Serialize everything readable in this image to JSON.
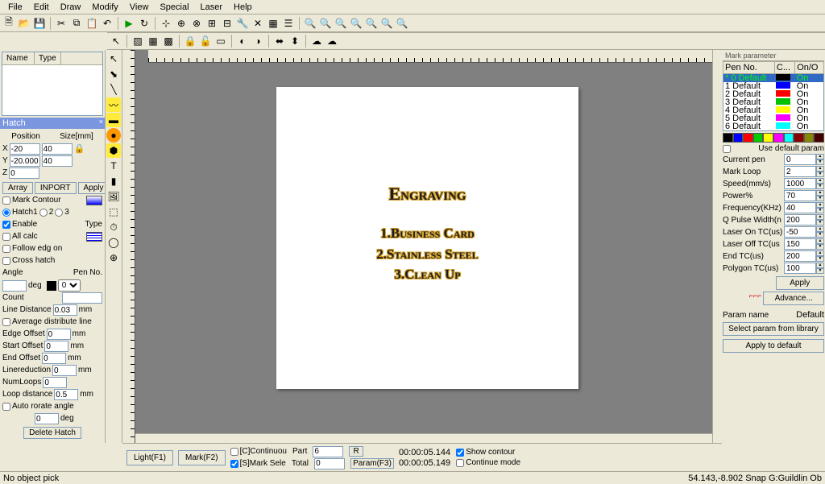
{
  "menu": [
    "File",
    "Edit",
    "Draw",
    "Modify",
    "View",
    "Special",
    "Laser",
    "Help"
  ],
  "toolbar1_icons": [
    "new-icon",
    "open-icon",
    "save-icon",
    "",
    "cut-icon",
    "copy-icon",
    "paste-icon",
    "undo-icon",
    "",
    "play-icon",
    "redo-icon",
    "",
    "snap1-icon",
    "snap2-icon",
    "snap3-icon",
    "snap4-icon",
    "snap5-icon",
    "tool1-icon",
    "tool2-icon",
    "grid-icon",
    "help-icon",
    "",
    "zoom-in-icon",
    "zoom-out-icon",
    "zoom-fit-icon",
    "zoom-sel-icon",
    "zoom1-icon",
    "zoom2-icon",
    "zoom3-icon"
  ],
  "toolbar2_icons": [
    "pointer-icon",
    "",
    "hatch1-icon",
    "hatch2-icon",
    "hatch3-icon",
    "",
    "lock-icon",
    "unlock-icon",
    "layer-icon",
    "",
    "shape1-icon",
    "shape2-icon",
    "",
    "mirror-h-icon",
    "mirror-v-icon",
    "",
    "group-icon",
    "ungroup-icon"
  ],
  "obj_list": {
    "col1": "Name",
    "col2": "Type"
  },
  "hatch_label": "Hatch",
  "position": {
    "header_pos": "Position",
    "header_size": "Size[mm]",
    "x": "X",
    "y": "Y",
    "z": "Z",
    "xpos": "-20",
    "xsize": "40",
    "ypos": "-20.000",
    "ysize": "40",
    "zpos": "0"
  },
  "buttons": {
    "array": "Array",
    "import": "INPORT",
    "apply": "Apply"
  },
  "mark_contour": "Mark Contour",
  "hatch_radio": {
    "h1": "Hatch1",
    "h2": "2",
    "h3": "3"
  },
  "hatch_opts": {
    "enable": "Enable",
    "type": "Type",
    "allcalc": "All calc",
    "follow": "Follow edg on",
    "cross": "Cross hatch",
    "angle": "Angle",
    "angle_val": "",
    "deg": "deg",
    "penno": "Pen No.",
    "pen_val": "0",
    "count": "Count",
    "count_val": "",
    "linedist": "Line Distance",
    "linedist_val": "0.03",
    "mm": "mm",
    "avgdist": "Average distribute line",
    "edgeoff": "Edge Offset",
    "edgeoff_val": "0",
    "startoff": "Start Offset",
    "startoff_val": "0",
    "endoff": "End Offset",
    "endoff_val": "0",
    "linered": "Linereduction",
    "linered_val": "0",
    "numloops": "NumLoops",
    "numloops_val": "0",
    "loopdist": "Loop distance",
    "loopdist_val": "0.5",
    "autorot": "Auto rorate angle",
    "autorot_val": "0",
    "delete": "Delete Hatch"
  },
  "canvas": {
    "title": "Engraving",
    "l1": "1.Business Card",
    "l2": "2.Stainless Steel",
    "l3": "3.Clean Up"
  },
  "right": {
    "title": "Mark parameter",
    "pen_hdr": {
      "no": "Pen No.",
      "c": "C...",
      "on": "On/O"
    },
    "pens": [
      {
        "n": "* 0 Default",
        "c": "#000000",
        "on": "On",
        "sel": true
      },
      {
        "n": "  1 Default",
        "c": "#0000ff",
        "on": "On"
      },
      {
        "n": "  2 Default",
        "c": "#ff0000",
        "on": "On"
      },
      {
        "n": "  3 Default",
        "c": "#00c000",
        "on": "On"
      },
      {
        "n": "  4 Default",
        "c": "#ffff00",
        "on": "On"
      },
      {
        "n": "  5 Default",
        "c": "#ff00ff",
        "on": "On"
      },
      {
        "n": "  6 Default",
        "c": "#00ffff",
        "on": "On"
      }
    ],
    "colors": [
      "#000",
      "#00f",
      "#f00",
      "#0c0",
      "#ff0",
      "#f0f",
      "#0ff",
      "#800",
      "#880",
      "#400"
    ],
    "usedefault": "Use default param",
    "params": [
      {
        "l": "Current pen",
        "v": "0"
      },
      {
        "l": "Mark Loop",
        "v": "2"
      },
      {
        "l": "Speed(mm/s)",
        "v": "1000"
      },
      {
        "l": "Power%",
        "v": "70"
      },
      {
        "l": "Frequency(KHz)",
        "v": "40"
      },
      {
        "l": "Q Pulse Width(n",
        "v": "200"
      },
      {
        "l": "Laser On TC(us)",
        "v": "-50"
      },
      {
        "l": "Laser Off TC(us",
        "v": "150"
      },
      {
        "l": "End TC(us)",
        "v": "200"
      },
      {
        "l": "Polygon TC(us)",
        "v": "100"
      }
    ],
    "apply": "Apply",
    "advance": "Advance...",
    "paramname_l": "Param name",
    "paramname_v": "Default",
    "selectlib": "Select param from library",
    "applytodef": "Apply to default"
  },
  "bottom": {
    "light": "Light(F1)",
    "mark": "Mark(F2)",
    "cont": "[C]Continuou",
    "part": "Part",
    "part_v": "6",
    "r": "R",
    "marksel": "[S]Mark Sele",
    "total": "Total",
    "total_v": "0",
    "param": "Param(F3)",
    "t1": "00:00:05.144",
    "showc": "Show contour",
    "t2": "00:00:05.149",
    "contmode": "Continue mode"
  },
  "status": {
    "left": "No object pick",
    "right": "54.143,-8.902 Snap G:Guildlin Ob"
  }
}
